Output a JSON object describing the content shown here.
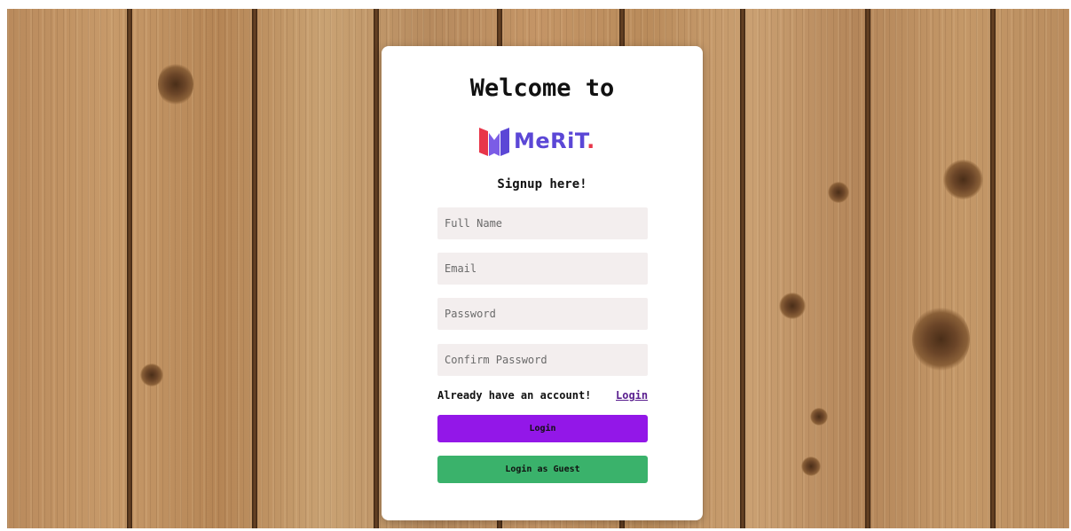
{
  "page": {
    "welcome_title": "Welcome to",
    "brand_name": "MeRiT",
    "brand_dot": ".",
    "subtitle": "Signup here!"
  },
  "form": {
    "full_name_placeholder": "Full Name",
    "email_placeholder": "Email",
    "password_placeholder": "Password",
    "confirm_password_placeholder": "Confirm Password",
    "already_text": "Already have an account!",
    "login_link": "Login",
    "login_button": "Login",
    "guest_button": "Login as Guest"
  },
  "colors": {
    "brand_purple": "#5b47d6",
    "brand_red": "#e8364a",
    "login_button_bg": "#9317e8",
    "guest_button_bg": "#3ab26b",
    "input_bg": "#f3eeee"
  }
}
